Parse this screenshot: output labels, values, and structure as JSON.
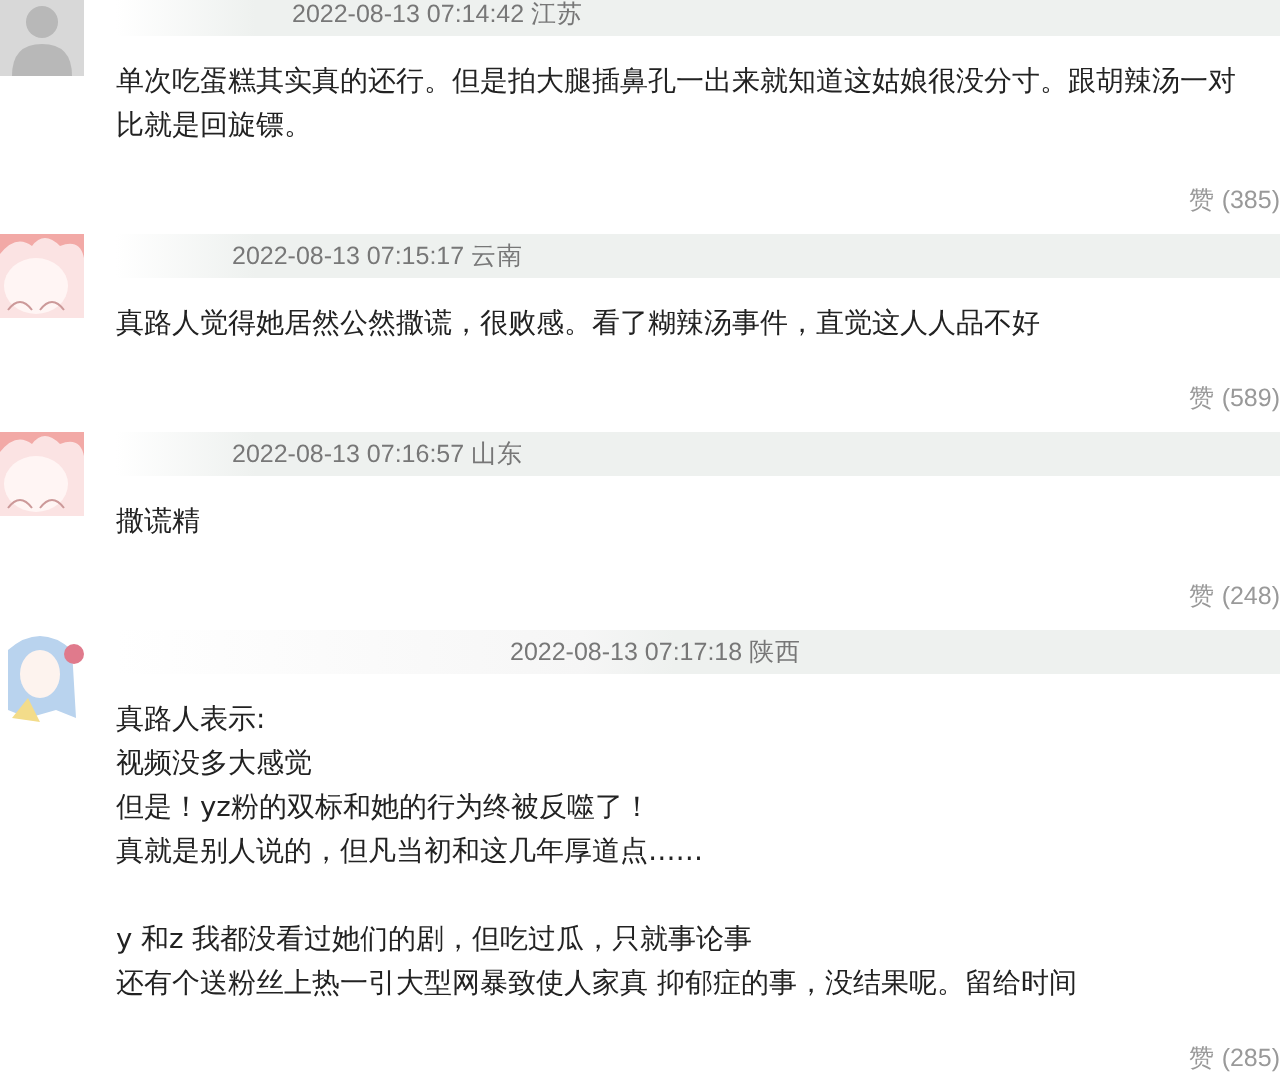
{
  "comments": [
    {
      "avatar": {
        "kind": "silhouette"
      },
      "time": "2022-08-13 07:14:42 江苏",
      "paragraphs": [
        [
          "单次吃蛋糕其实真的还行。但是拍大腿插鼻孔一出来就知道这姑娘很没分寸。跟胡辣汤一对比就是回旋镖。"
        ]
      ],
      "likes": "赞 (385)"
    },
    {
      "avatar": {
        "kind": "pink"
      },
      "time": "2022-08-13 07:15:17 云南",
      "paragraphs": [
        [
          "真路人觉得她居然公然撒谎，很败感。看了糊辣汤事件，直觉这人人品不好"
        ]
      ],
      "likes": "赞 (589)"
    },
    {
      "avatar": {
        "kind": "pink"
      },
      "time": "2022-08-13 07:16:57 山东",
      "paragraphs": [
        [
          "撒谎精"
        ]
      ],
      "likes": "赞 (248)"
    },
    {
      "avatar": {
        "kind": "sketch"
      },
      "time": "2022-08-13 07:17:18 陕西",
      "paragraphs": [
        [
          "真路人表示:",
          "视频没多大感觉",
          "但是！yz粉的双标和她的行为终被反噬了！",
          "真就是别人说的，但凡当初和这几年厚道点……"
        ],
        [
          "y 和z 我都没看过她们的剧，但吃过瓜，只就事论事",
          "还有个送粉丝上热一引大型网暴致使人家真 抑郁症的事，没结果呢。留给时间"
        ]
      ],
      "likes": "赞 (285)"
    }
  ]
}
